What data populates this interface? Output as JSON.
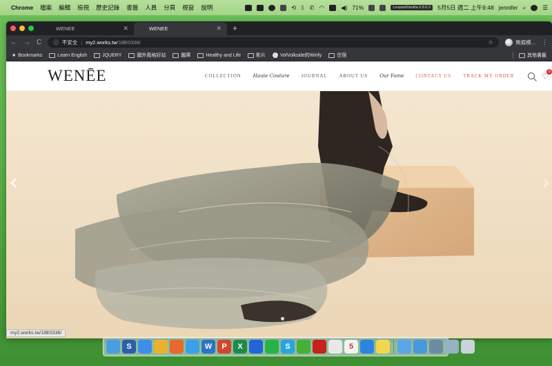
{
  "menubar": {
    "app": "Chrome",
    "menus": [
      "檔案",
      "編輯",
      "檢視",
      "歷史記錄",
      "書籤",
      "人員",
      "分頁",
      "視窗",
      "說明"
    ],
    "battery": "71%",
    "leopard": "LeopardVanilla 0.8.0.3",
    "datetime": "5月5日 週二 上午9:48",
    "user": "jennifer"
  },
  "browser": {
    "tabs": [
      {
        "title": "WENEE",
        "active": false
      },
      {
        "title": "WENEE",
        "active": true
      }
    ],
    "omnibox": {
      "security": "不安全",
      "url_host": "my2.works.tw",
      "url_path": "/18E0336/"
    },
    "profile_name": "無痕模...",
    "bookmarks": [
      {
        "label": "Bookmarks",
        "icon": "star-icon"
      },
      {
        "label": "Learn English",
        "icon": "folder-icon"
      },
      {
        "label": "JQUERY",
        "icon": "folder-icon"
      },
      {
        "label": "國外風格好站",
        "icon": "folder-icon"
      },
      {
        "label": "圖庫",
        "icon": "folder-icon"
      },
      {
        "label": "Healthy and Life",
        "icon": "folder-icon"
      },
      {
        "label": "影片",
        "icon": "folder-icon"
      },
      {
        "label": "VolVolkside的Wirify",
        "icon": "volvolkside-icon"
      },
      {
        "label": "住宿",
        "icon": "folder-icon"
      }
    ],
    "other_bookmarks": "其他書籤",
    "status_url": "my2.works.tw/18E0336/"
  },
  "site": {
    "logo": "WENĒE",
    "nav": [
      {
        "label": "COLLECTION",
        "style": "plain"
      },
      {
        "label": "Haute Couture",
        "style": "script"
      },
      {
        "label": "JOURNAL",
        "style": "plain"
      },
      {
        "label": "ABOUT US",
        "style": "plain"
      },
      {
        "label": "Our Fame",
        "style": "script"
      },
      {
        "label": "CONTACT US",
        "style": "accent"
      },
      {
        "label": "TRACK MY ORDER",
        "style": "accent"
      }
    ],
    "wishlist_count": "0",
    "slider_dots": 1
  },
  "colors": {
    "accent": "#d9534f",
    "hero_bg": "#f1e1c7",
    "badge": "#e02a2a"
  },
  "dock": [
    {
      "name": "finder-icon",
      "color": "#4a9de0",
      "glyph": ""
    },
    {
      "name": "sourcetree-icon",
      "color": "#2c5fa8",
      "glyph": "S"
    },
    {
      "name": "safari-icon",
      "color": "#3c8ee8",
      "glyph": ""
    },
    {
      "name": "chrome-icon",
      "color": "#e8b22c",
      "glyph": ""
    },
    {
      "name": "firefox-icon",
      "color": "#e8672c",
      "glyph": ""
    },
    {
      "name": "twitter-icon",
      "color": "#3ca0e8",
      "glyph": ""
    },
    {
      "name": "word-icon",
      "color": "#2b73c9",
      "glyph": "W"
    },
    {
      "name": "powerpoint-icon",
      "color": "#d0472e",
      "glyph": "P"
    },
    {
      "name": "excel-icon",
      "color": "#1e8a4a",
      "glyph": "X"
    },
    {
      "name": "dropbox-icon",
      "color": "#2166d9",
      "glyph": ""
    },
    {
      "name": "line-icon",
      "color": "#27b34a",
      "glyph": ""
    },
    {
      "name": "skype-icon",
      "color": "#2aa3e3",
      "glyph": "S"
    },
    {
      "name": "wechat-icon",
      "color": "#45b035",
      "glyph": ""
    },
    {
      "name": "acrobat-icon",
      "color": "#c8201b",
      "glyph": ""
    },
    {
      "name": "textedit-icon",
      "color": "#e8e8e8",
      "glyph": ""
    },
    {
      "name": "calendar-icon",
      "color": "#f2f2f2",
      "glyph": "5"
    },
    {
      "name": "facetime-icon",
      "color": "#2c84e0",
      "glyph": ""
    },
    {
      "name": "notes-icon",
      "color": "#f2d64e",
      "glyph": ""
    },
    {
      "name": "folder-stack-icon",
      "color": "#5aa6e6",
      "glyph": ""
    },
    {
      "name": "downloads-icon",
      "color": "#4a97de",
      "glyph": ""
    },
    {
      "name": "preview-icon",
      "color": "#6c8aa0",
      "glyph": ""
    },
    {
      "name": "documents-icon",
      "color": "#9ab0c4",
      "glyph": ""
    },
    {
      "name": "trash-icon",
      "color": "#c9d3da",
      "glyph": ""
    }
  ]
}
